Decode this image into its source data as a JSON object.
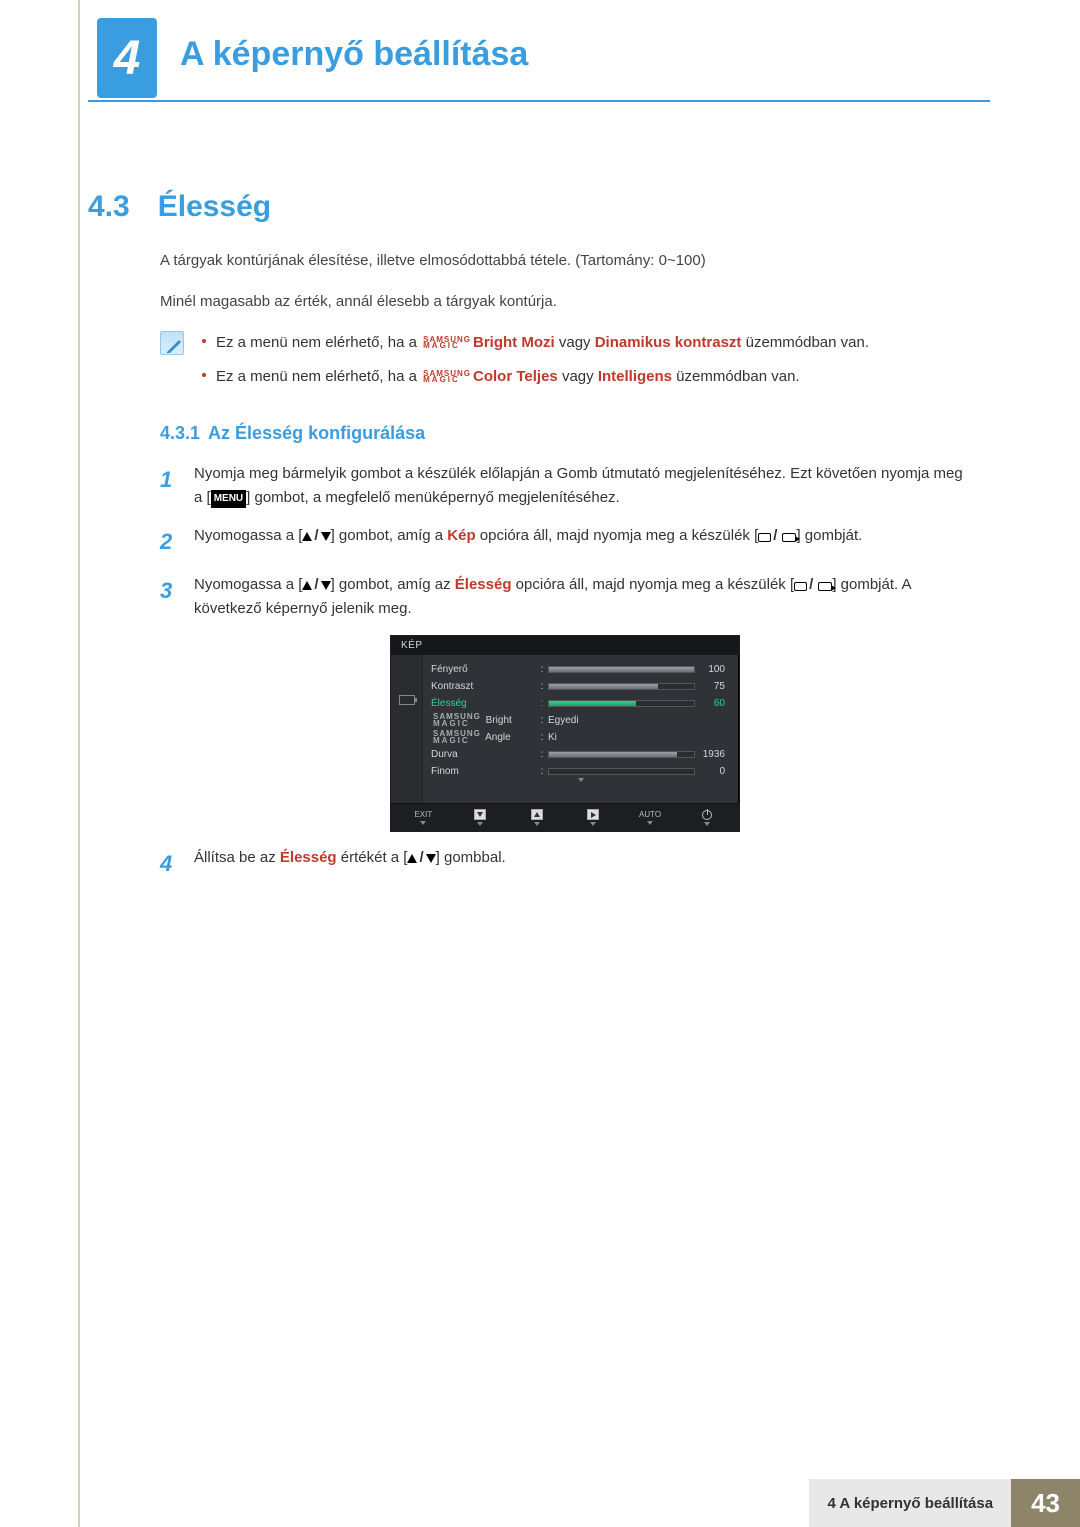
{
  "chapter": {
    "number": "4",
    "title": "A képernyő beállítása"
  },
  "section": {
    "number": "4.3",
    "title": "Élesség"
  },
  "paras": {
    "p1": "A tárgyak kontúrjának élesítése, illetve elmosódottabbá tétele. (Tartomány: 0~100)",
    "p2": "Minél magasabb az érték, annál élesebb a tárgyak kontúrja."
  },
  "magic": {
    "l1": "SAMSUNG",
    "l2": "MAGIC"
  },
  "notes": {
    "n1_a": "Ez a menü nem elérhető, ha a ",
    "n1_b": "Bright",
    "n1_c": " Mozi",
    "n1_d": " vagy ",
    "n1_e": "Dinamikus kontraszt",
    "n1_f": " üzemmódban van.",
    "n2_a": "Ez a menü nem elérhető, ha a ",
    "n2_b": "Color",
    "n2_c": " Teljes",
    "n2_d": " vagy ",
    "n2_e": "Intelligens",
    "n2_f": " üzemmódban van."
  },
  "subsection": {
    "number": "4.3.1",
    "title": "Az Élesség konfigurálása"
  },
  "steps": {
    "s1_a": "Nyomja meg bármelyik gombot a készülék előlapján a Gomb útmutató megjelenítéséhez. Ezt követően nyomja meg a [",
    "s1_b": "] gombot, a megfelelő menüképernyő megjelenítéséhez.",
    "menu": "MENU",
    "s2_a": "Nyomogassa a [",
    "s2_b": "] gombot, amíg a ",
    "s2_kep": "Kép",
    "s2_c": " opcióra áll, majd nyomja meg a készülék [",
    "s2_d": "] gombját.",
    "s3_a": "Nyomogassa a [",
    "s3_b": "] gombot, amíg az ",
    "s3_el": "Élesség",
    "s3_c": " opcióra áll, majd nyomja meg a készülék [",
    "s3_d": "] gombját. A következő képernyő jelenik meg.",
    "s4_a": "Állítsa be az ",
    "s4_el": "Élesség",
    "s4_b": " értékét a [",
    "s4_c": "] gombbal."
  },
  "osd": {
    "title": "KÉP",
    "rows": [
      {
        "label": "Fényerő",
        "type": "bar",
        "value": 100,
        "max": 100
      },
      {
        "label": "Kontraszt",
        "type": "bar",
        "value": 75,
        "max": 100
      },
      {
        "label": "Élesség",
        "type": "bar",
        "value": 60,
        "max": 100,
        "active": true
      },
      {
        "label": "MAGIC Bright",
        "type": "text",
        "text": "Egyedi",
        "magic": true
      },
      {
        "label": "MAGIC Angle",
        "type": "text",
        "text": "Ki",
        "magic": true
      },
      {
        "label": "Durva",
        "type": "bar",
        "value": 1936,
        "max": 2200
      },
      {
        "label": "Finom",
        "type": "bar",
        "value": 0,
        "max": 100
      }
    ],
    "footer": {
      "exit": "EXIT",
      "auto": "AUTO"
    }
  },
  "footer": {
    "label": "4 A képernyő beállítása",
    "page": "43"
  }
}
